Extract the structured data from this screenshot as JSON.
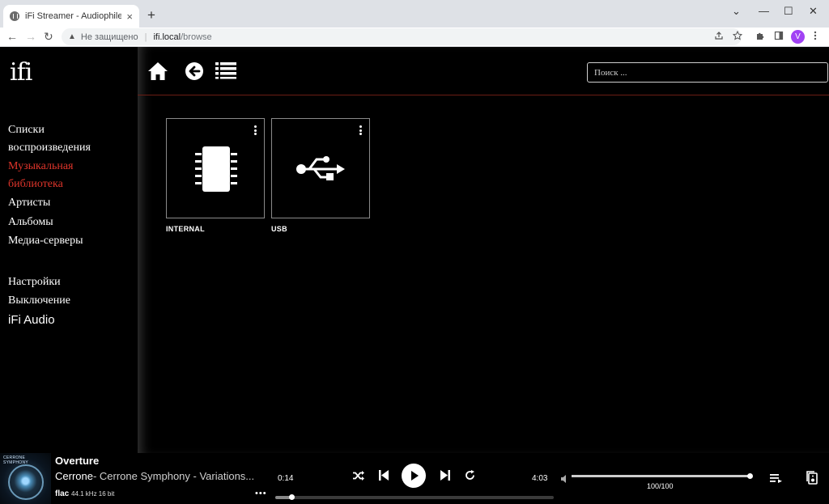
{
  "browser": {
    "tab_title": "iFi Streamer - Audiophile Music Pl",
    "tab_close": "×",
    "new_tab": "+",
    "minimize": "⌄",
    "window_min": "—",
    "window_max": "☐",
    "window_close": "✕",
    "back": "←",
    "forward": "→",
    "reload": "↻",
    "security_warning": "▲",
    "security_label": "Не защищено",
    "separator": "|",
    "url_host": "ifi.local",
    "url_path": "/browse",
    "profile_initial": "V"
  },
  "app": {
    "logo": "ifi",
    "menu": {
      "playlists": "Списки воспроизведения",
      "music_library": "Музыкальная библиотека",
      "artists": "Артисты",
      "albums": "Альбомы",
      "media_servers": "Медиа-серверы",
      "settings": "Настройки",
      "shutdown": "Выключение",
      "ifi_audio": "iFi Audio"
    },
    "search": {
      "placeholder": "Поиск ..."
    },
    "sources": [
      {
        "label": "INTERNAL",
        "icon": "chip-icon"
      },
      {
        "label": "USB",
        "icon": "usb-icon"
      }
    ]
  },
  "player": {
    "cover_text": "CERRONE SYMPHONY",
    "title": "Overture",
    "artist": "Cerrone",
    "album_desc": "- Cerrone Symphony - Variations...",
    "format": "flac",
    "rate": "44.1 kHz 16 bit",
    "more": "•••",
    "elapsed": "0:14",
    "total": "4:03",
    "progress": 0.058,
    "volume_label": "100/100",
    "volume": 1.0
  },
  "colors": {
    "accent_red": "#e0352b",
    "profile": "#a142f4"
  }
}
